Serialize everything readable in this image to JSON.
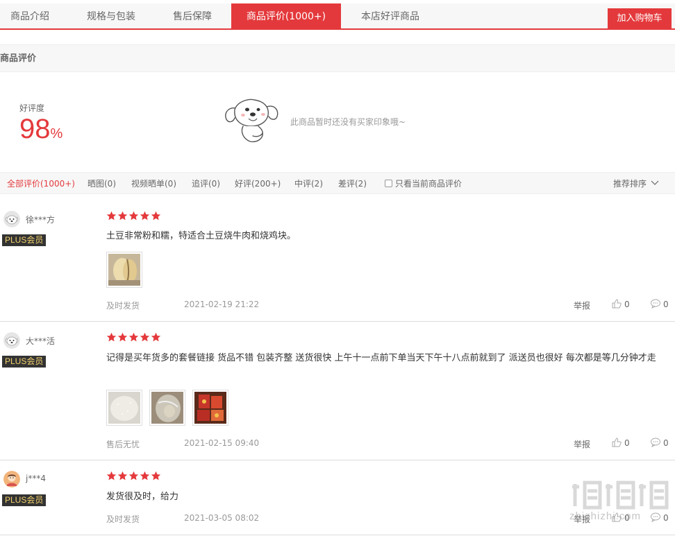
{
  "tabs": [
    {
      "label": "商品介绍",
      "active": false
    },
    {
      "label": "规格与包装",
      "active": false
    },
    {
      "label": "售后保障",
      "active": false
    },
    {
      "label": "商品评价(1000+)",
      "active": true
    },
    {
      "label": "本店好评商品",
      "active": false
    }
  ],
  "cart_button": "加入购物车",
  "section_title": "商品评价",
  "rating": {
    "label": "好评度",
    "value": "98",
    "unit": "%",
    "empty_tip": "此商品暂时还没有买家印象哦~"
  },
  "filters": [
    {
      "label": "全部评价(1000+)",
      "active": true
    },
    {
      "label": "晒图(0)",
      "active": false
    },
    {
      "label": "视频晒单(0)",
      "active": false
    },
    {
      "label": "追评(0)",
      "active": false
    },
    {
      "label": "好评(200+)",
      "active": false
    },
    {
      "label": "中评(2)",
      "active": false
    },
    {
      "label": "差评(2)",
      "active": false
    }
  ],
  "only_current_label": "只看当前商品评价",
  "sort_label": "推荐排序",
  "report_label": "举报",
  "reviews": [
    {
      "user": "徐***方",
      "badge": "PLUS会员",
      "stars": 5,
      "content": "土豆非常粉和糯，特适合土豆烧牛肉和烧鸡块。",
      "tag": "及时发货",
      "time": "2021-02-19 21:22",
      "likes": "0",
      "replies": "0",
      "avatar": "dog-avatar",
      "photos": [
        "potato-photo"
      ]
    },
    {
      "user": "大***活",
      "badge": "PLUS会员",
      "stars": 5,
      "content": "记得是买年货多的套餐链接 货品不错 包装齐整 送货很快 上午十一点前下单当天下午十八点前就到了 派送员也很好 每次都是等几分钟才走",
      "tag": "售后无忧",
      "time": "2021-02-15 09:40",
      "likes": "0",
      "replies": "0",
      "avatar": "dog-avatar",
      "photos": [
        "rice-photo",
        "bag-photo",
        "snack-photo"
      ]
    },
    {
      "user": "j***4",
      "badge": "PLUS会员",
      "stars": 5,
      "content": "发货很及时，给力",
      "tag": "及时发货",
      "time": "2021-03-05 08:02",
      "likes": "0",
      "replies": "0",
      "avatar": "person-avatar",
      "photos": []
    }
  ],
  "watermark": "zhizhizhi.com",
  "colors": {
    "accent": "#e4393c",
    "plus_bg": "#333333",
    "plus_text": "#f5d26d"
  }
}
